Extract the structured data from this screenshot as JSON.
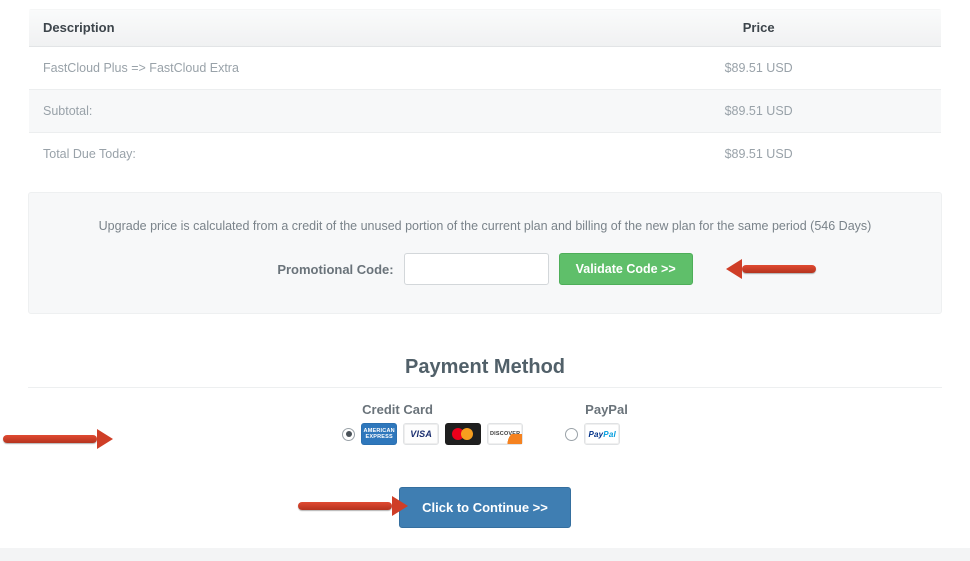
{
  "table": {
    "col_description": "Description",
    "col_price": "Price",
    "rows": [
      {
        "desc": "FastCloud Plus => FastCloud Extra",
        "price": "$89.51 USD"
      },
      {
        "desc": "Subtotal:",
        "price": "$89.51 USD"
      },
      {
        "desc": "Total Due Today:",
        "price": "$89.51 USD"
      }
    ]
  },
  "notice": {
    "text": "Upgrade price is calculated from a credit of the unused portion of the current plan and billing of the new plan for the same period (546 Days)",
    "promo_label": "Promotional Code:",
    "promo_value": "",
    "validate_label": "Validate Code >>"
  },
  "payment": {
    "heading": "Payment Method",
    "cc_label": "Credit Card",
    "paypal_label": "PayPal",
    "selected": "cc"
  },
  "continue_label": "Click to Continue >>",
  "icons": {
    "amex": "AMERICAN EXPRESS",
    "visa": "VISA",
    "discover": "DISCOVER",
    "paypal_a": "Pay",
    "paypal_b": "Pal"
  }
}
